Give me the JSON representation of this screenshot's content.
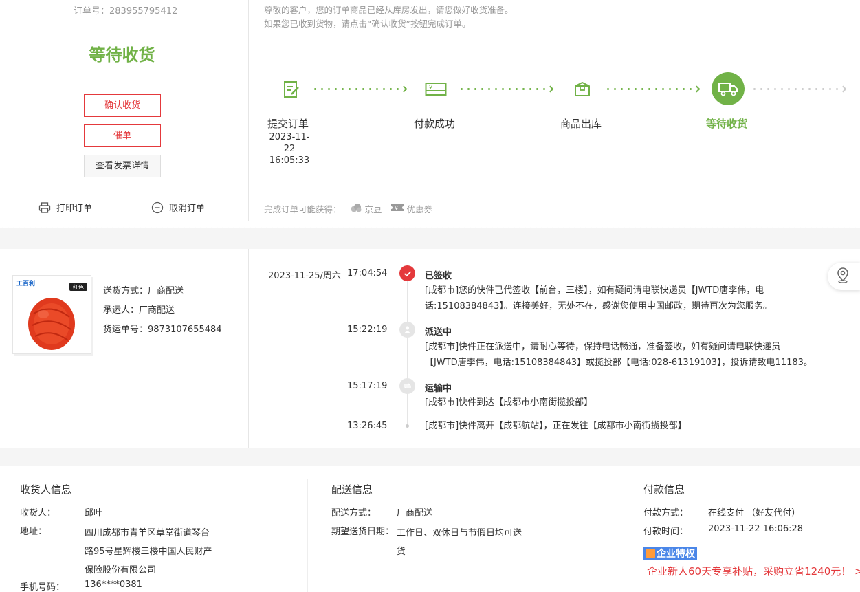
{
  "order": {
    "order_no_label": "订单号：",
    "order_no": "283955795412",
    "status": "等待收货",
    "buttons": {
      "confirm": "确认收货",
      "urge": "催单",
      "invoice": "查看发票详情"
    },
    "actions": {
      "print": "打印订单",
      "cancel": "取消订单"
    }
  },
  "notice": {
    "line1": "尊敬的客户，您的订单商品已经从库房发出，请您做好收货准备。",
    "line2": "如果您已收到货物，请点击“确认收货”按钮完成订单。"
  },
  "steps": [
    {
      "label": "提交订单",
      "date": "2023-11-22",
      "time": "16:05:33",
      "icon": "edit-doc-icon",
      "active": false
    },
    {
      "label": "付款成功",
      "icon": "card-icon",
      "active": false
    },
    {
      "label": "商品出库",
      "icon": "package-icon",
      "active": false
    },
    {
      "label": "等待收货",
      "icon": "truck-icon",
      "active": true
    }
  ],
  "rewards": {
    "label": "完成订单可能获得：",
    "items": [
      {
        "label": "京豆",
        "icon": "jingdou-icon"
      },
      {
        "label": "优惠券",
        "icon": "coupon-icon"
      }
    ]
  },
  "shipping": {
    "method": "送货方式：厂商配送",
    "carrier": "承运人：厂商配送",
    "tracking_no": "货运单号：9873107655484",
    "product_badge": "红色",
    "product_brand": "工百利"
  },
  "tracking": [
    {
      "date": "2023-11-25/周六",
      "time": "17:04:54",
      "status": "已签收",
      "node": "check-icon",
      "lines": [
        "[成都市]您的快件已代签收【前台，三楼】，如有疑问请电联快递员【JWTD唐李伟，电",
        "话:15108384843】。连接美好，无处不在，感谢您使用中国邮政，期待再次为您服务。"
      ]
    },
    {
      "date": "",
      "time": "15:22:19",
      "status": "派送中",
      "node": "courier-icon",
      "lines": [
        "[成都市]快件正在派送中，请耐心等待，保持电话畅通，准备签收，如有疑问请电联快递员",
        "【JWTD唐李伟，电话:15108384843】或揽投部【电话:028-61319103】，投诉请致电11183。"
      ]
    },
    {
      "date": "",
      "time": "15:17:19",
      "status": "运输中",
      "node": "transit-icon",
      "lines": [
        "[成都市]快件到达【成都市小南街揽投部】"
      ]
    },
    {
      "date": "",
      "time": "13:26:45",
      "status": "",
      "node": "dot",
      "lines": [
        "[成都市]快件离开【成都航站】，正在发往【成都市小南街揽投部】"
      ]
    }
  ],
  "consignee": {
    "title": "收货人信息",
    "name_label": "收货人：",
    "name": "邱叶",
    "address_label": "地址：",
    "address_lines": [
      "四川成都市青羊区草堂街道琴台",
      "路95号星辉楼三楼中国人民财产",
      "保险股份有限公司"
    ],
    "phone_label": "手机号码：",
    "phone": "136****0381"
  },
  "delivery": {
    "title": "配送信息",
    "method_label": "配送方式：",
    "method": "厂商配送",
    "date_label": "期望送货日期：",
    "date_lines": [
      "工作日、双休日与节假日均可送",
      "货"
    ]
  },
  "payment": {
    "title": "付款信息",
    "method_label": "付款方式：",
    "method": "在线支付 （好友代付）",
    "time_label": "付款时间：",
    "time": "2023-11-22 16:06:28",
    "badge": "企业特权",
    "promo": "企业新人60天专享补贴，采购立省1240元！ >"
  },
  "colors": {
    "accent_green": "#71b247",
    "accent_red": "#e4393c",
    "badge_blue": "#4a86e8"
  }
}
